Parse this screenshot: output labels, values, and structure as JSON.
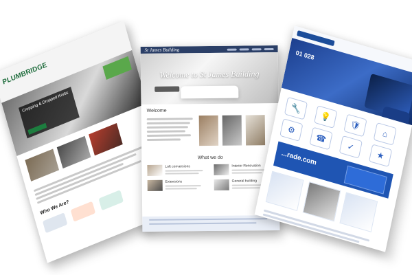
{
  "left_site": {
    "logo_main": "PLUMBRIDGE",
    "headline": "Cropping & Dropped Kerbs",
    "section_heading": "Who We Are?"
  },
  "center_site": {
    "hero_title": "Welcome to St James Building",
    "welcome_heading": "Welcome",
    "what_we_do_heading": "What we do",
    "services": [
      {
        "title": "Loft conversions"
      },
      {
        "title": "Interior Renovation"
      },
      {
        "title": "Extensions"
      },
      {
        "title": "General building"
      }
    ]
  },
  "right_site": {
    "phone_partial": "01 028",
    "domain_partial": "...rade.com"
  }
}
